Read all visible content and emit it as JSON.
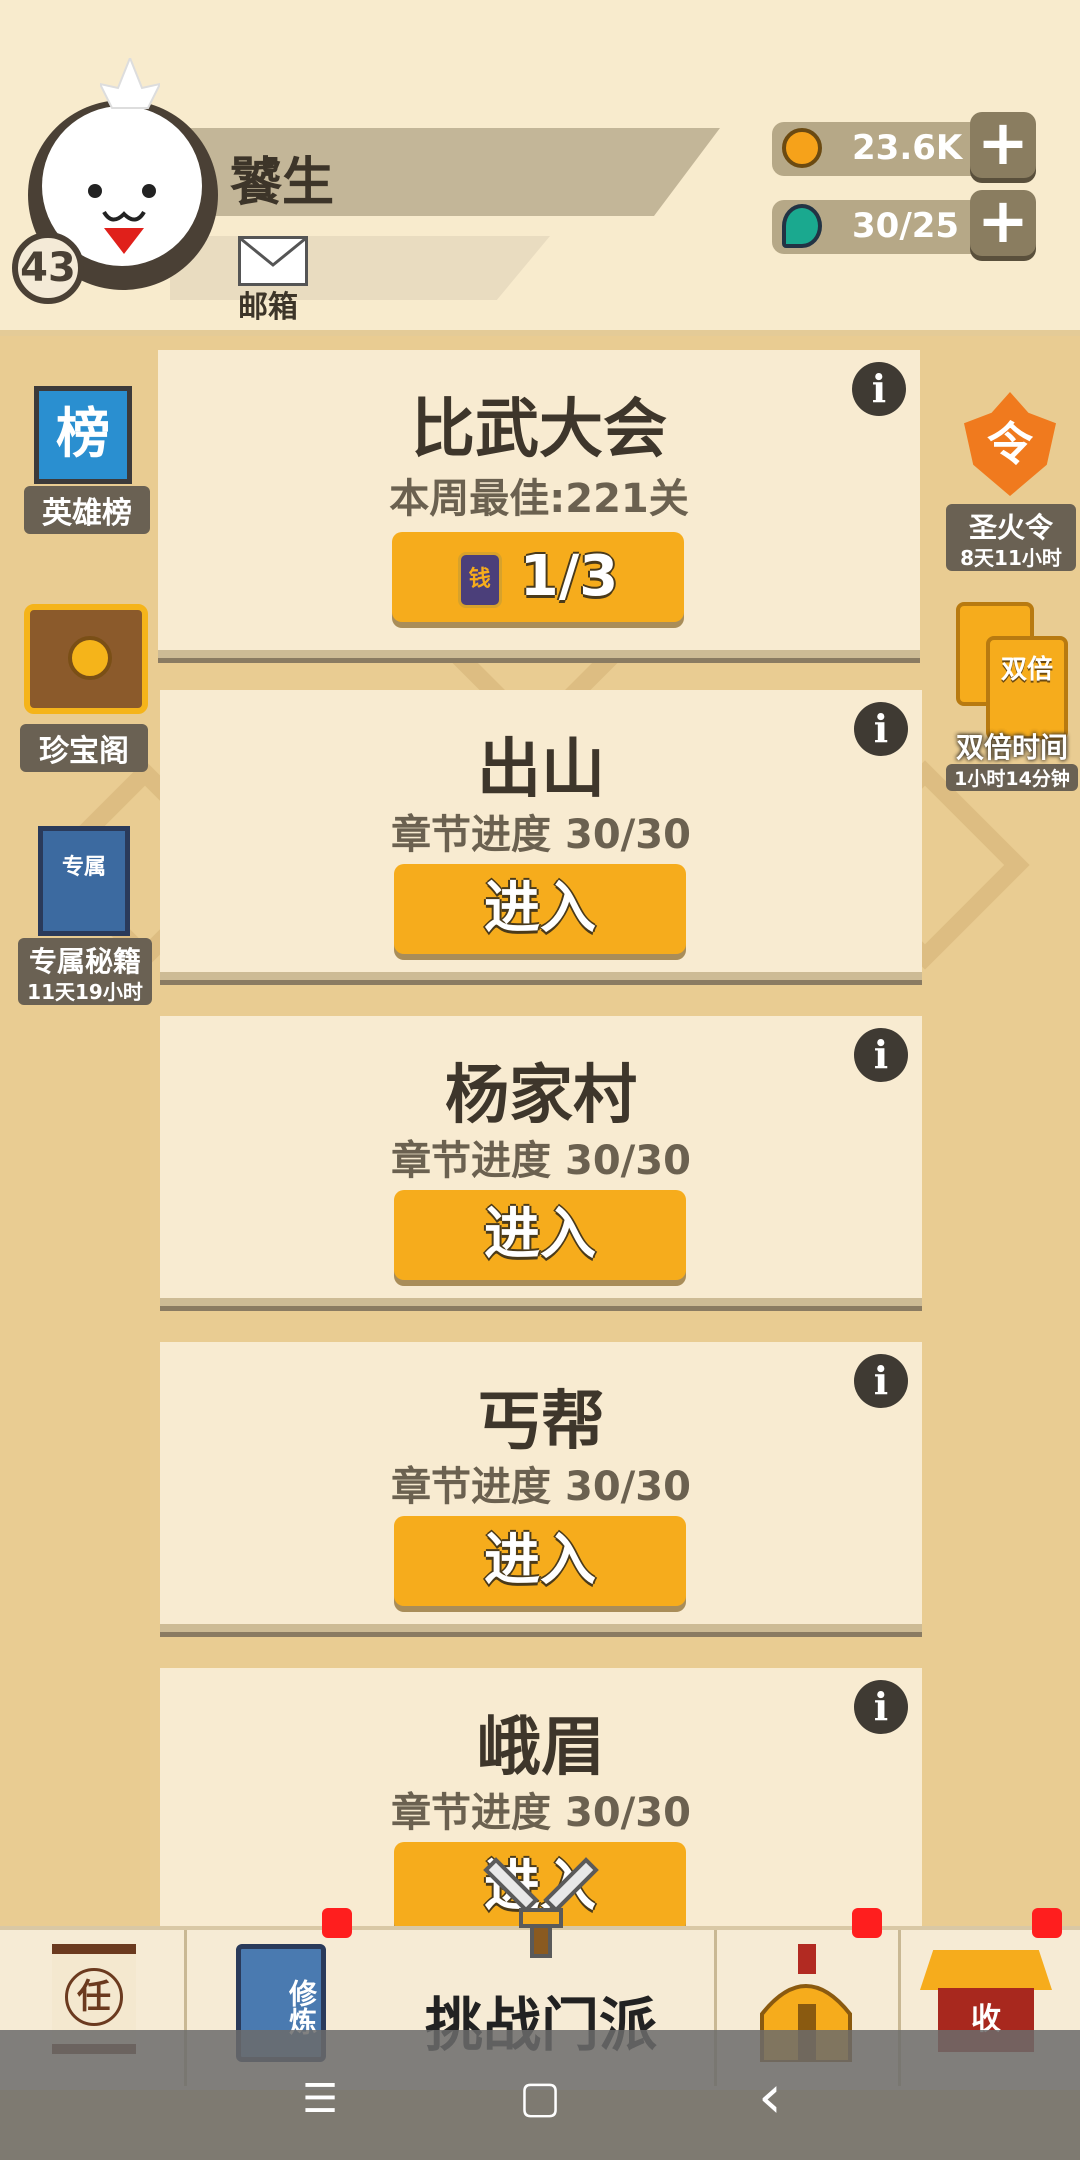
{
  "player": {
    "name": "饕生",
    "level": "43",
    "mail_label": "邮箱"
  },
  "resources": {
    "gold": "23.6K",
    "stamina": "30/25",
    "plus": "+"
  },
  "left_sidebar": [
    {
      "icon_text": "榜",
      "label": "英雄榜",
      "sub": ""
    },
    {
      "label": "珍宝阁",
      "sub": ""
    },
    {
      "icon_text": "专属",
      "label": "专属秘籍",
      "sub": "11天19小时"
    }
  ],
  "right_sidebar": [
    {
      "icon_text": "令",
      "label": "圣火令",
      "sub": "8天11小时"
    },
    {
      "icon_text": "双倍",
      "label": "双倍时间",
      "sub": "1小时14分钟"
    }
  ],
  "cards": [
    {
      "title": "比武大会",
      "subtitle": "本周最佳:221关",
      "button": "1/3",
      "coin_text": "钱"
    },
    {
      "title": "出山",
      "subtitle": "章节进度 30/30",
      "button": "进入"
    },
    {
      "title": "杨家村",
      "subtitle": "章节进度 30/30",
      "button": "进入"
    },
    {
      "title": "丐帮",
      "subtitle": "章节进度 30/30",
      "button": "进入"
    },
    {
      "title": "峨眉",
      "subtitle": "章节进度 30/30",
      "button": "进入"
    }
  ],
  "info_glyph": "i",
  "bottom_nav": {
    "task_icon_text": "任",
    "train_icon_text": "修炼",
    "center_label": "挑战门派",
    "collect_icon_text": "收"
  },
  "system_bar": {
    "menu": "☰",
    "home": "▢",
    "back": "‹"
  },
  "colors": {
    "accent_button": "#f6ac1c",
    "card_bg": "#f8ebd1",
    "page_bg": "#e9cc92",
    "badge_red": "#ff1e1e"
  }
}
